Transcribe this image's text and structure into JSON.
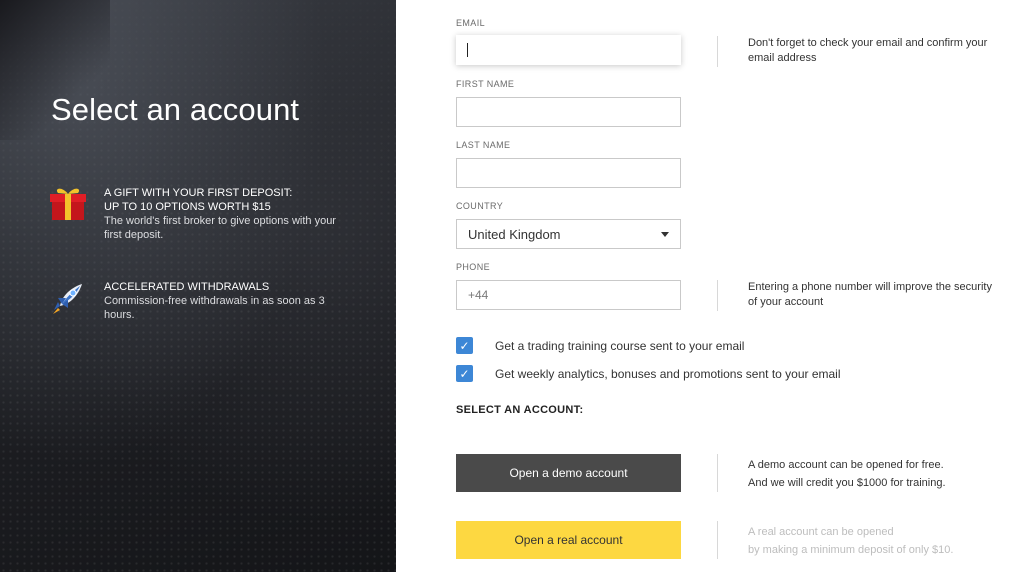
{
  "left": {
    "title": "Select an account",
    "features": [
      {
        "icon": "gift-icon",
        "heading_1": "A GIFT WITH YOUR FIRST DEPOSIT:",
        "heading_2": "UP TO 10 OPTIONS WORTH $15",
        "body": "The world's first broker to give options with your first deposit."
      },
      {
        "icon": "rocket-icon",
        "heading_1": "ACCELERATED WITHDRAWALS",
        "body": "Commission-free withdrawals in as soon as 3 hours."
      }
    ]
  },
  "form": {
    "email": {
      "label": "EMAIL",
      "value": ""
    },
    "first_name": {
      "label": "FIRST NAME",
      "value": ""
    },
    "last_name": {
      "label": "LAST NAME",
      "value": ""
    },
    "country": {
      "label": "COUNTRY",
      "value": "United Kingdom"
    },
    "phone": {
      "label": "PHONE",
      "value": "+44"
    },
    "checkboxes": [
      {
        "label": "Get a trading training course sent to your email",
        "checked": true
      },
      {
        "label": "Get weekly analytics, bonuses and promotions sent to your email",
        "checked": true
      }
    ],
    "section_title": "SELECT AN ACCOUNT:",
    "demo_button": "Open a demo account",
    "real_button": "Open a real account"
  },
  "hints": {
    "email": "Don't forget to check your email and confirm your email address",
    "phone": "Entering a phone number will improve the security of your account",
    "demo_1": "A demo account can be opened for free.",
    "demo_2": "And we will credit you $1000 for training.",
    "real_1": "A real account can be opened",
    "real_2": "by making a minimum deposit of only $10."
  },
  "colors": {
    "checkbox": "#3d87d6",
    "demo_button": "#4a4a4a",
    "real_button": "#fdd841",
    "left_panel": "#1b1c20"
  }
}
